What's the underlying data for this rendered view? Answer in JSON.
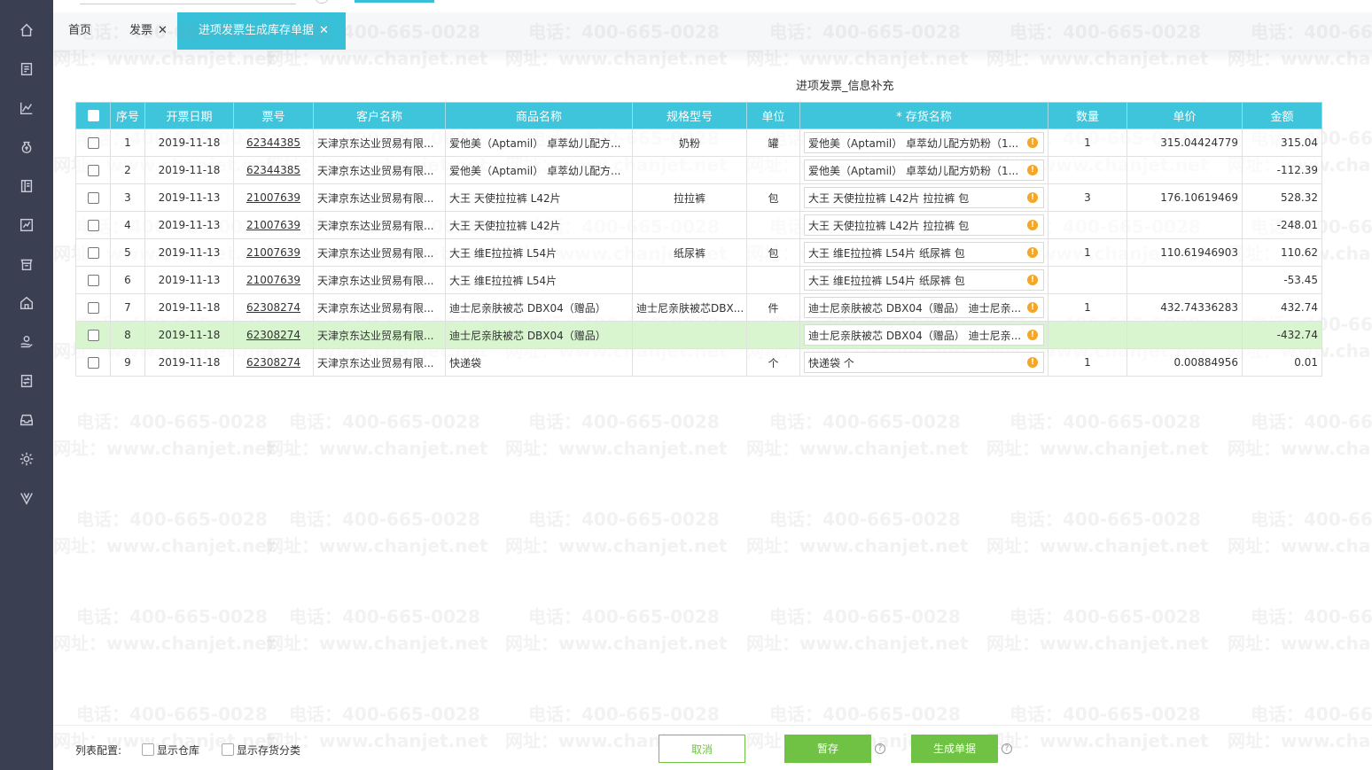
{
  "tabs": [
    {
      "label": "首页",
      "closable": false,
      "active": false
    },
    {
      "label": "发票",
      "closable": true,
      "active": false
    },
    {
      "label": "进项发票生成库存单据",
      "closable": true,
      "active": true
    }
  ],
  "form_title": "进项发票_信息补充",
  "columns": [
    "序号",
    "开票日期",
    "票号",
    "客户名称",
    "商品名称",
    "规格型号",
    "单位",
    "* 存货名称",
    "数量",
    "单价",
    "金额"
  ],
  "rows": [
    {
      "no": "1",
      "date": "2019-11-18",
      "ticket": "62344385",
      "customer": "天津京东达业贸易有限...",
      "product": "爱他美（Aptamil） 卓萃幼儿配方...",
      "spec": "奶粉",
      "unit": "罐",
      "inventory": "爱他美（Aptamil） 卓萃幼儿配方奶粉（1...",
      "qty": "1",
      "price": "315.04424779",
      "amount": "315.04",
      "highlight": false
    },
    {
      "no": "2",
      "date": "2019-11-18",
      "ticket": "62344385",
      "customer": "天津京东达业贸易有限...",
      "product": "爱他美（Aptamil） 卓萃幼儿配方...",
      "spec": "",
      "unit": "",
      "inventory": "爱他美（Aptamil） 卓萃幼儿配方奶粉（1...",
      "qty": "",
      "price": "",
      "amount": "-112.39",
      "highlight": false
    },
    {
      "no": "3",
      "date": "2019-11-13",
      "ticket": "21007639",
      "customer": "天津京东达业贸易有限...",
      "product": "大王 天使拉拉裤 L42片",
      "spec": "拉拉裤",
      "unit": "包",
      "inventory": "大王 天使拉拉裤 L42片 拉拉裤 包",
      "qty": "3",
      "price": "176.10619469",
      "amount": "528.32",
      "highlight": false
    },
    {
      "no": "4",
      "date": "2019-11-13",
      "ticket": "21007639",
      "customer": "天津京东达业贸易有限...",
      "product": "大王 天使拉拉裤 L42片",
      "spec": "",
      "unit": "",
      "inventory": "大王 天使拉拉裤 L42片 拉拉裤 包",
      "qty": "",
      "price": "",
      "amount": "-248.01",
      "highlight": false
    },
    {
      "no": "5",
      "date": "2019-11-13",
      "ticket": "21007639",
      "customer": "天津京东达业贸易有限...",
      "product": "大王 维E拉拉裤 L54片",
      "spec": "纸尿裤",
      "unit": "包",
      "inventory": "大王 维E拉拉裤 L54片 纸尿裤 包",
      "qty": "1",
      "price": "110.61946903",
      "amount": "110.62",
      "highlight": false
    },
    {
      "no": "6",
      "date": "2019-11-13",
      "ticket": "21007639",
      "customer": "天津京东达业贸易有限...",
      "product": "大王 维E拉拉裤 L54片",
      "spec": "",
      "unit": "",
      "inventory": "大王 维E拉拉裤 L54片 纸尿裤 包",
      "qty": "",
      "price": "",
      "amount": "-53.45",
      "highlight": false
    },
    {
      "no": "7",
      "date": "2019-11-18",
      "ticket": "62308274",
      "customer": "天津京东达业贸易有限...",
      "product": "迪士尼亲肤被芯 DBX04（赠品）",
      "spec": "迪士尼亲肤被芯DBX...",
      "unit": "件",
      "inventory": "迪士尼亲肤被芯 DBX04（赠品） 迪士尼亲...",
      "qty": "1",
      "price": "432.74336283",
      "amount": "432.74",
      "highlight": false
    },
    {
      "no": "8",
      "date": "2019-11-18",
      "ticket": "62308274",
      "customer": "天津京东达业贸易有限...",
      "product": "迪士尼亲肤被芯 DBX04（赠品）",
      "spec": "",
      "unit": "",
      "inventory": "迪士尼亲肤被芯 DBX04（赠品） 迪士尼亲...",
      "qty": "",
      "price": "",
      "amount": "-432.74",
      "highlight": true
    },
    {
      "no": "9",
      "date": "2019-11-18",
      "ticket": "62308274",
      "customer": "天津京东达业贸易有限...",
      "product": "快递袋",
      "spec": "",
      "unit": "个",
      "inventory": "快递袋 个",
      "qty": "1",
      "price": "0.00884956",
      "amount": "0.01",
      "highlight": false
    }
  ],
  "footer": {
    "config_label": "列表配置:",
    "show_warehouse": "显示仓库",
    "show_category": "显示存货分类",
    "cancel": "取消",
    "save_draft": "暂存",
    "generate": "生成单据"
  },
  "watermark": {
    "phone": "电话：400-665-0028",
    "site": "网址：www.chanjet.net"
  },
  "colors": {
    "accent": "#38c0d8",
    "sidebar": "#3a3f51",
    "green": "#6fc243",
    "warning": "#f5a623",
    "highlight_row": "#d8f5cf"
  }
}
